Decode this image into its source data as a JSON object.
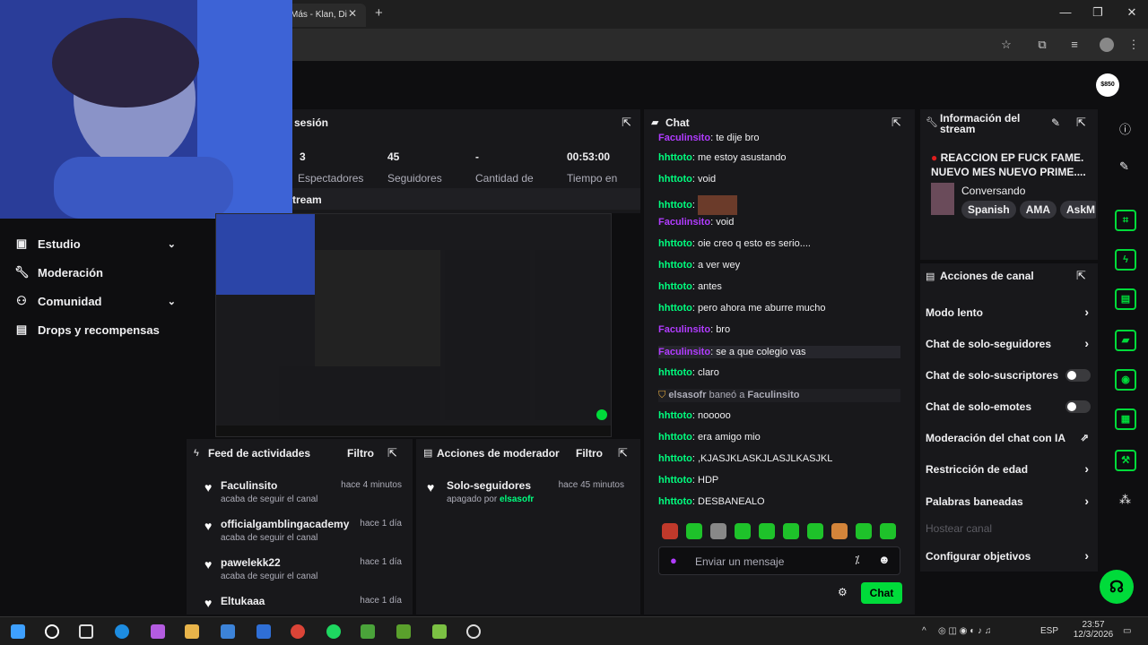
{
  "browser": {
    "tab_title": "Más - Klan, Di",
    "tab_close": "✕",
    "new_tab": "+",
    "minimize": "—",
    "maximize": "❐",
    "close": "✕"
  },
  "header": {
    "avatar_text": "$850"
  },
  "sidebar": {
    "items": [
      {
        "label": "Estudio",
        "icon": "video-icon",
        "has_chevron": true
      },
      {
        "label": "Moderación",
        "icon": "wrench-icon",
        "has_chevron": false
      },
      {
        "label": "Comunidad",
        "icon": "people-icon",
        "has_chevron": true
      },
      {
        "label": "Drops y recompensas",
        "icon": "gift-icon",
        "has_chevron": false
      }
    ]
  },
  "stats": {
    "title": "sesión",
    "items": [
      {
        "value": "3",
        "label": "Espectadores"
      },
      {
        "value": "45",
        "label": "Seguidores"
      },
      {
        "value": "-",
        "label": "Cantidad de"
      },
      {
        "value": "00:53:00",
        "label": "Tiempo en"
      }
    ],
    "stream_label": "tream"
  },
  "feed": {
    "title": "Feed de actividades",
    "filter": "Filtro",
    "items": [
      {
        "name": "Faculinsito",
        "sub": "acaba de seguir el canal",
        "time": "hace 4 minutos"
      },
      {
        "name": "officialgamblingacademy",
        "sub": "acaba de seguir el canal",
        "time": "hace 1 día"
      },
      {
        "name": "pawelekk22",
        "sub": "acaba de seguir el canal",
        "time": "hace 1 día"
      },
      {
        "name": "Eltukaaa",
        "sub": "",
        "time": "hace 1 día"
      }
    ]
  },
  "modactions": {
    "title": "Acciones de moderador",
    "filter": "Filtro",
    "items": [
      {
        "name": "Solo-seguidores",
        "sub_prefix": "apagado por",
        "by": "elsasofr",
        "time": "hace 45 minutos"
      }
    ]
  },
  "chat": {
    "title": "Chat",
    "messages": [
      {
        "user": "Faculinsito",
        "color": "purple",
        "text": "te dije bro"
      },
      {
        "user": "hhttoto",
        "color": "green",
        "text": "me estoy asustando"
      },
      {
        "user": "hhttoto",
        "color": "green",
        "text": "void"
      },
      {
        "user": "hhttoto",
        "color": "green",
        "text": ""
      },
      {
        "user": "Faculinsito",
        "color": "purple",
        "text": "void"
      },
      {
        "user": "hhttoto",
        "color": "green",
        "text": "oie creo q esto es serio...."
      },
      {
        "user": "hhttoto",
        "color": "green",
        "text": "a ver wey"
      },
      {
        "user": "hhttoto",
        "color": "green",
        "text": "antes"
      },
      {
        "user": "hhttoto",
        "color": "green",
        "text": "pero ahora me aburre mucho"
      },
      {
        "user": "Faculinsito",
        "color": "purple",
        "text": "bro"
      },
      {
        "user": "Faculinsito",
        "color": "purple",
        "text": "se a que colegio vas"
      },
      {
        "user": "hhttoto",
        "color": "green",
        "text": "claro"
      },
      {
        "user": "hhttoto",
        "color": "green",
        "text": "nooooo"
      },
      {
        "user": "hhttoto",
        "color": "green",
        "text": "era amigo mio"
      },
      {
        "user": "hhttoto",
        "color": "green",
        "text": ",KJASJKLASKJLASJLKASJKL"
      },
      {
        "user": "hhttoto",
        "color": "green",
        "text": "HDP"
      },
      {
        "user": "hhttoto",
        "color": "green",
        "text": "DESBANEALO"
      }
    ],
    "ban_notice": {
      "mod": "elsasofr",
      "action": "baneó a",
      "target": "Faculinsito"
    },
    "input_placeholder": "Enviar un mensaje",
    "send_label": "Chat"
  },
  "stream_info": {
    "title": "Información del stream",
    "stream_title": "REACCION EP FUCK FAME. NUEVO MES NUEVO PRIME....",
    "category": "Conversando",
    "tags": [
      "Spanish",
      "AMA",
      "AskM"
    ]
  },
  "channel_actions": {
    "title": "Acciones de canal",
    "items": [
      {
        "label": "Modo lento",
        "control": "chevron"
      },
      {
        "label": "Chat de solo-seguidores",
        "control": "chevron"
      },
      {
        "label": "Chat de solo-suscriptores",
        "control": "toggle"
      },
      {
        "label": "Chat de solo-emotes",
        "control": "toggle"
      },
      {
        "label": "Moderación del chat con IA",
        "control": "external"
      },
      {
        "label": "Restricción de edad",
        "control": "chevron"
      },
      {
        "label": "Palabras baneadas",
        "control": "chevron"
      },
      {
        "label": "Hostear canal",
        "control": "none",
        "disabled": true
      },
      {
        "label": "Configurar objetivos",
        "control": "chevron"
      }
    ]
  },
  "taskbar": {
    "lang": "ESP",
    "time": "23:57",
    "date": "12/3/2026"
  },
  "colors": {
    "accent": "#00db3a",
    "chat_green": "#00ff7f",
    "chat_purple": "#b13cff"
  }
}
